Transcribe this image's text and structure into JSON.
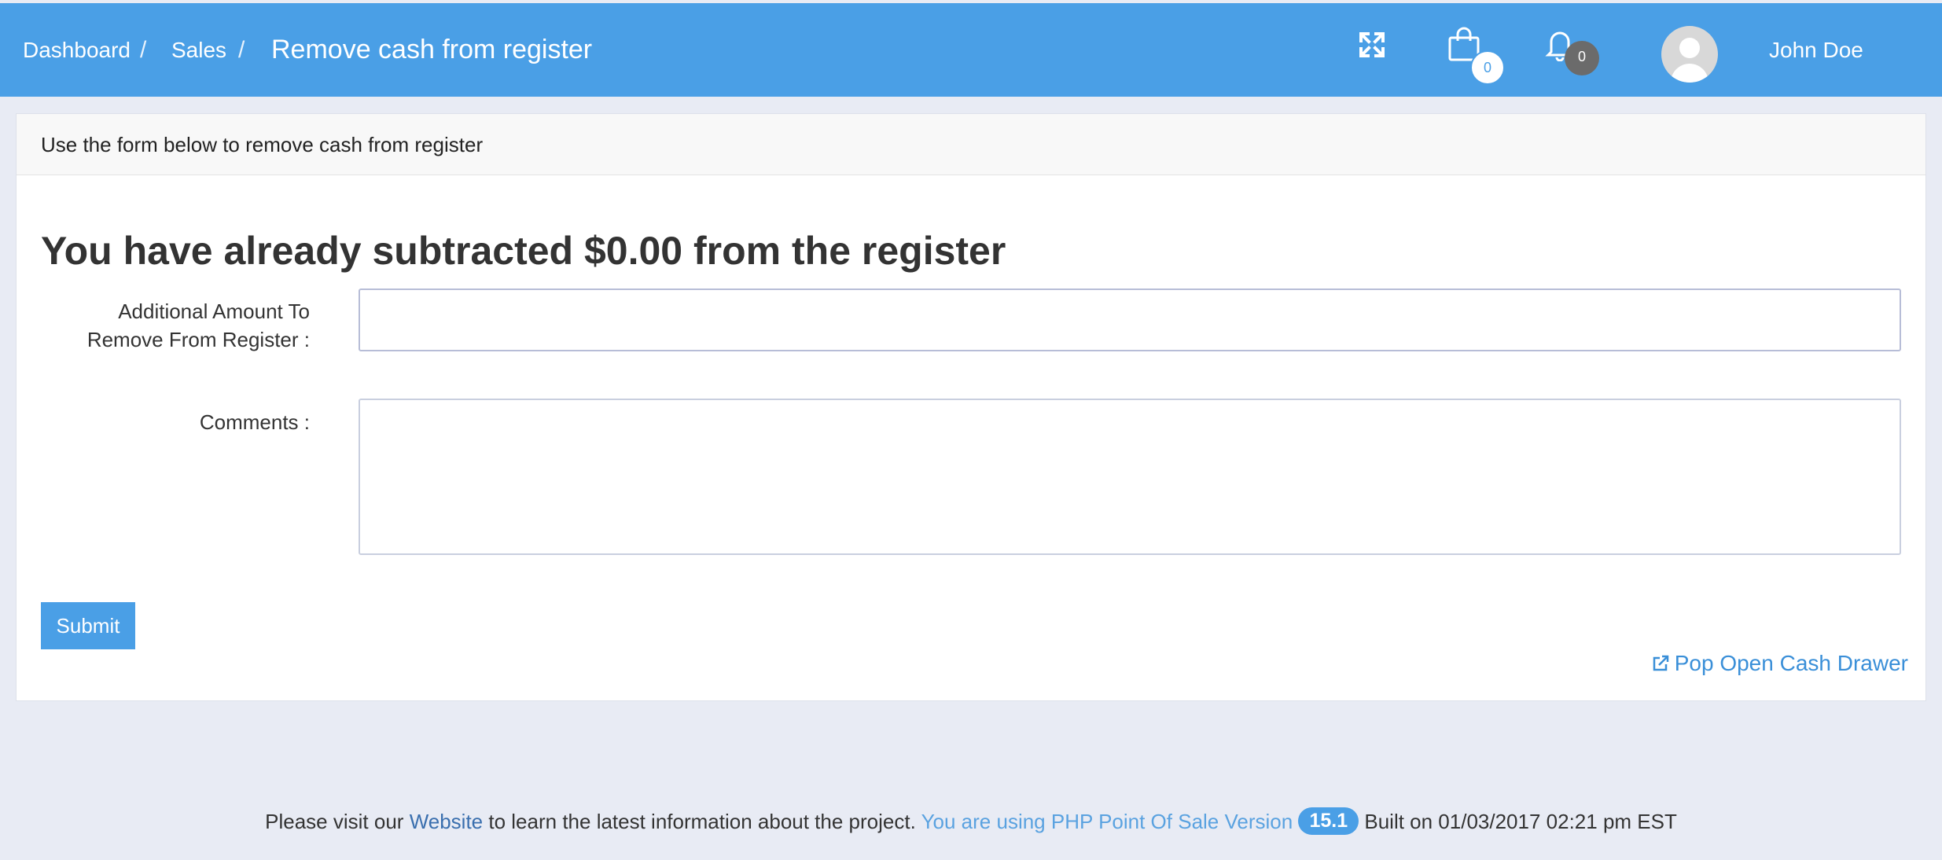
{
  "header": {
    "breadcrumbs": [
      "Dashboard",
      "Sales"
    ],
    "separator": "/",
    "current": "Remove cash from register",
    "cart_count": "0",
    "notification_count": "0",
    "user_name": "John Doe"
  },
  "panel": {
    "heading": "Use the form below to remove cash from register",
    "title": "You have already subtracted $0.00 from the register",
    "amount_label_line1": "Additional Amount To",
    "amount_label_line2": "Remove From Register :",
    "amount_value": "",
    "comments_label": "Comments :",
    "comments_value": "",
    "submit_label": "Submit",
    "cash_drawer_link": "Pop Open Cash Drawer"
  },
  "footer": {
    "text1": "Please visit our",
    "website_link": "Website",
    "text2": "to learn the latest information about the project.",
    "version_text": "You are using PHP Point Of Sale Version",
    "version": "15.1",
    "built": "Built on 01/03/2017 02:21 pm EST"
  },
  "colors": {
    "accent": "#4a9fe6",
    "background": "#e8ebf4"
  },
  "icons": [
    "fullscreen-icon",
    "shopping-bag-icon",
    "bell-icon",
    "avatar-icon",
    "external-link-icon"
  ]
}
